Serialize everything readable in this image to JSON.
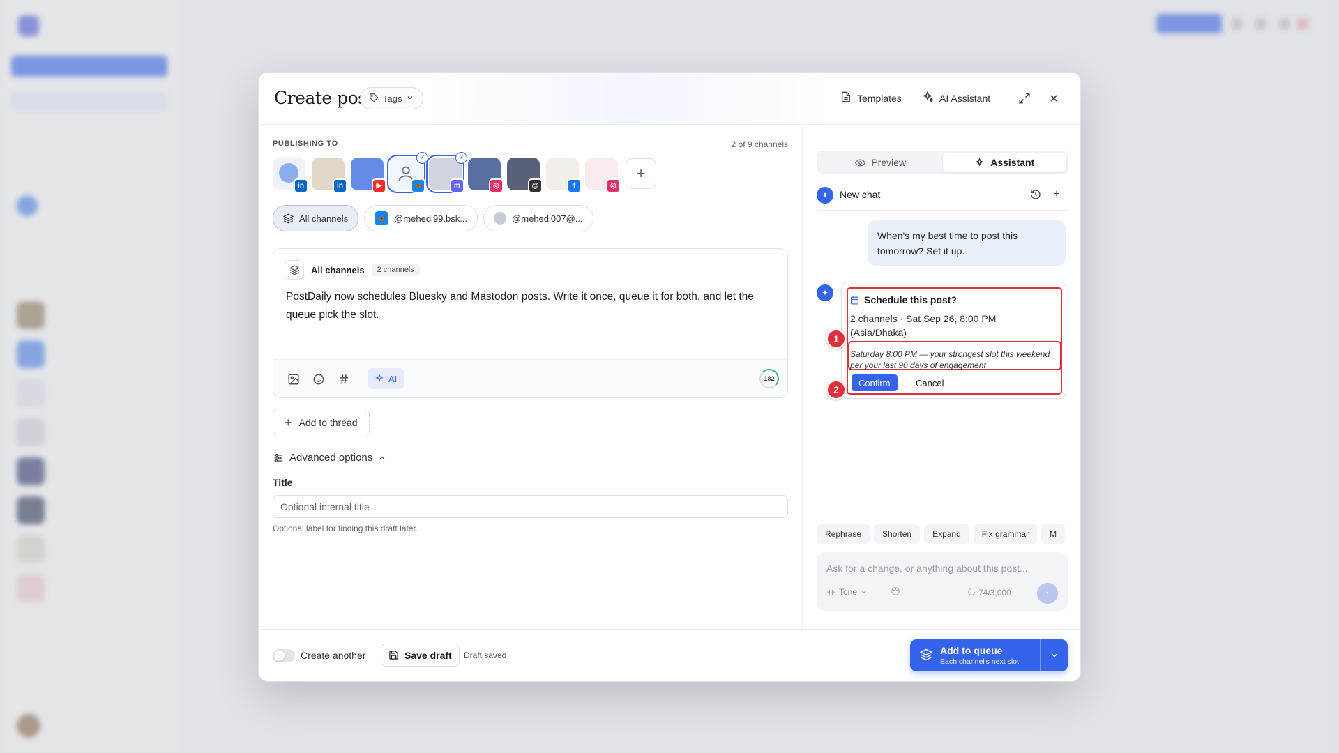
{
  "modal": {
    "title": "Create post",
    "tags_label": "Tags",
    "templates_label": "Templates",
    "ai_assistant_label": "AI Assistant"
  },
  "publishing": {
    "label": "PUBLISHING TO",
    "count": "2 of 9 channels",
    "channels": [
      {
        "network": "linkedin",
        "selected": false,
        "color": "#0a66c2"
      },
      {
        "network": "linkedin",
        "selected": false,
        "color": "#0a66c2"
      },
      {
        "network": "youtube",
        "selected": false,
        "color": "#ff2d2d"
      },
      {
        "network": "bluesky",
        "selected": true,
        "color": "#1185fe"
      },
      {
        "network": "mastodon",
        "selected": true,
        "color": "#6364ff"
      },
      {
        "network": "instagram",
        "selected": false,
        "color": "#e1306c"
      },
      {
        "network": "threads",
        "selected": false,
        "color": "#333333"
      },
      {
        "network": "facebook",
        "selected": false,
        "color": "#1877f2"
      },
      {
        "network": "instagram",
        "selected": false,
        "color": "#e1306c"
      }
    ],
    "chips": {
      "all": "All channels",
      "bluesky": "@mehedi99.bsk...",
      "mastodon": "@mehedi007@..."
    }
  },
  "editor": {
    "header": "All channels",
    "badge": "2 channels",
    "text": "PostDaily now schedules Bluesky and Mastodon posts. Write it once, queue it for both, and let the queue pick the slot.",
    "ai_label": "AI",
    "char_count": "182"
  },
  "thread_label": "Add to thread",
  "advanced": {
    "label": "Advanced options",
    "title_label": "Title",
    "title_placeholder": "Optional internal title",
    "title_help": "Optional label for finding this draft later."
  },
  "assistant": {
    "tabs": {
      "preview": "Preview",
      "assistant": "Assistant"
    },
    "chat_title": "New chat",
    "user_message": "When's my best time to post this tomorrow? Set it up.",
    "card": {
      "title": "Schedule this post?",
      "meta": "2 channels · Sat Sep 26, 8:00 PM (Asia/Dhaka)",
      "reason": "Saturday 8:00 PM — your strongest slot this weekend per your last 90 days of engagement",
      "confirm": "Confirm",
      "cancel": "Cancel"
    },
    "markers": [
      "1",
      "2"
    ],
    "quick_actions": [
      "Rephrase",
      "Shorten",
      "Expand",
      "Fix grammar",
      "M"
    ],
    "input_placeholder": "Ask for a change, or anything about this post...",
    "tone_label": "Tone",
    "char_count": "74/3,000"
  },
  "footer": {
    "create_another": "Create another",
    "save_draft": "Save draft",
    "draft_status": "Draft saved",
    "queue_title": "Add to queue",
    "queue_sub": "Each channel's next slot"
  },
  "colors": {
    "accent": "#3563e9",
    "highlight": "#e0303a"
  }
}
